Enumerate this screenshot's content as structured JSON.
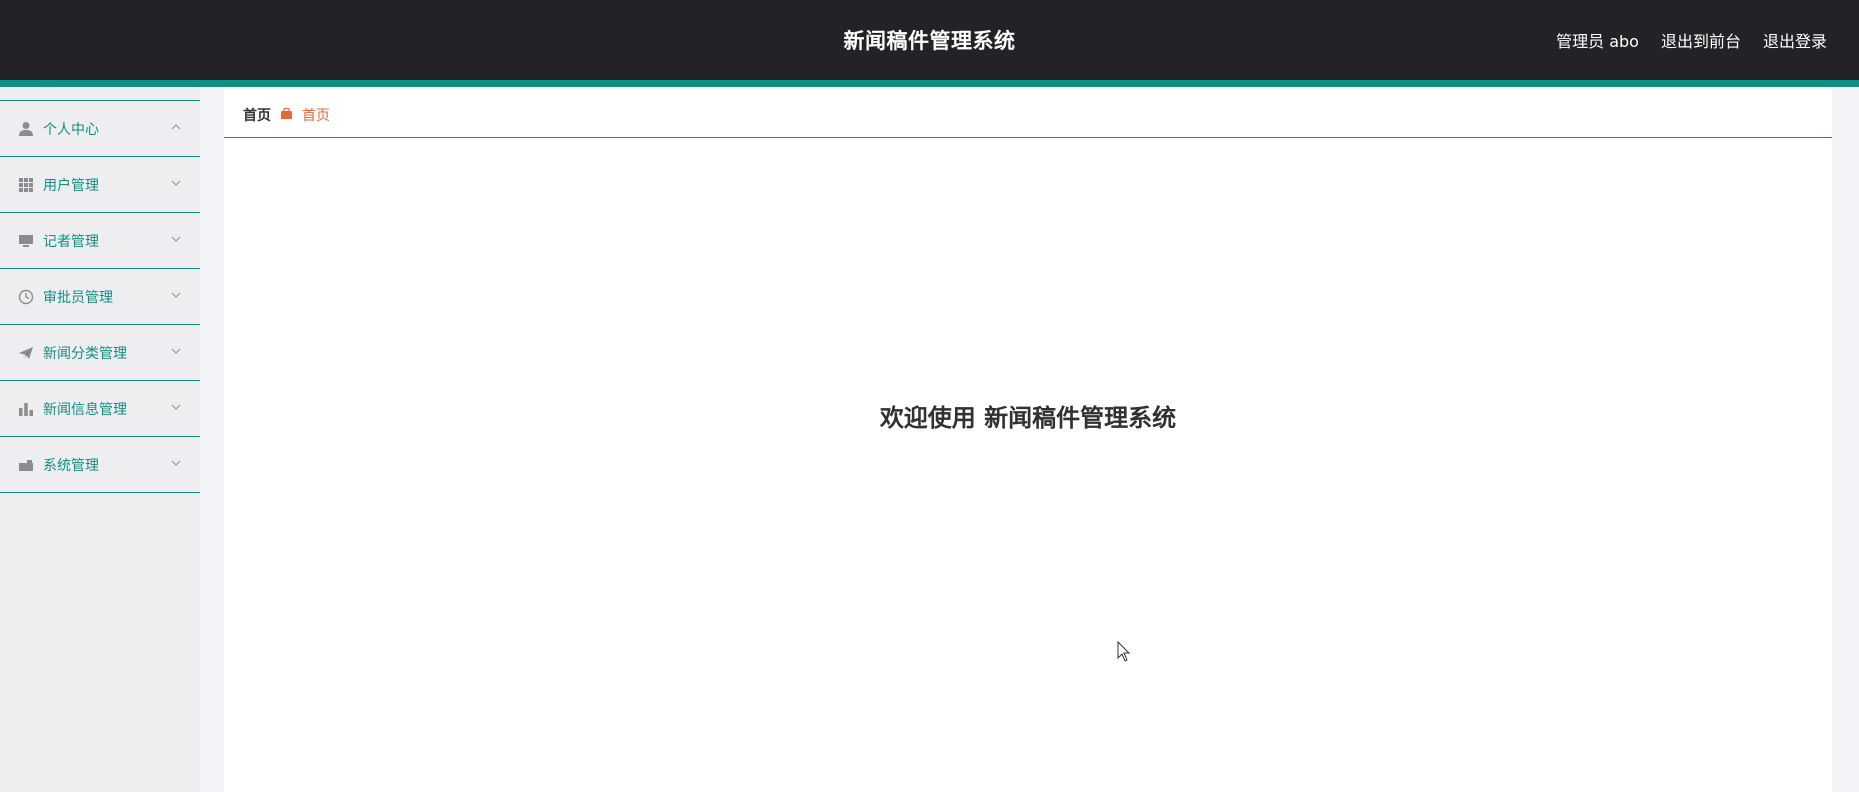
{
  "header": {
    "title": "新闻稿件管理系统",
    "user_label": "管理员 abo",
    "to_front_label": "退出到前台",
    "logout_label": "退出登录"
  },
  "sidebar": {
    "home_label": "首页",
    "items": [
      {
        "label": "个人中心",
        "icon": "user-icon",
        "expanded": true
      },
      {
        "label": "用户管理",
        "icon": "grid-icon",
        "expanded": false
      },
      {
        "label": "记者管理",
        "icon": "monitor-icon",
        "expanded": false
      },
      {
        "label": "审批员管理",
        "icon": "clock-icon",
        "expanded": false
      },
      {
        "label": "新闻分类管理",
        "icon": "send-icon",
        "expanded": false
      },
      {
        "label": "新闻信息管理",
        "icon": "bar-chart-icon",
        "expanded": false
      },
      {
        "label": "系统管理",
        "icon": "briefcase-icon",
        "expanded": false
      }
    ]
  },
  "breadcrumb": {
    "home": "首页",
    "current": "首页"
  },
  "main": {
    "welcome": "欢迎使用 新闻稿件管理系统"
  },
  "colors": {
    "header_bg": "#232226",
    "accent": "#128f83",
    "breadcrumb_active": "#e4693a",
    "sidebar_bg": "#eeeef0"
  }
}
